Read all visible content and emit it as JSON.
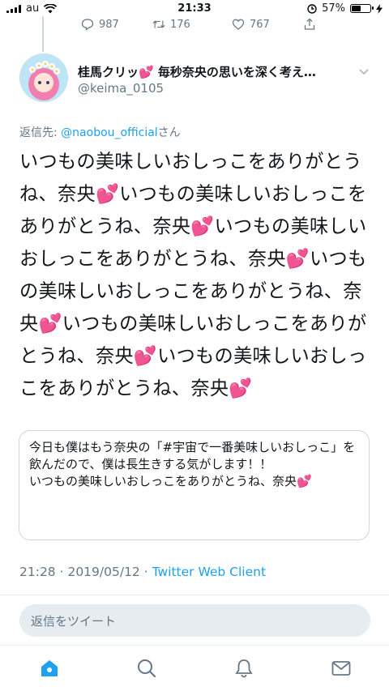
{
  "status_bar": {
    "carrier": "au",
    "time": "21:33",
    "battery_percent": "57%",
    "battery_level": 0.57
  },
  "previous_tweet_stats": {
    "replies": "987",
    "retweets": "176",
    "likes": "767"
  },
  "author": {
    "display_name": "桂馬クリッ💕 毎秒奈央の思いを深く考え…",
    "handle": "@keima_0105"
  },
  "reply_to": {
    "prefix": "返信先: ",
    "target": "@naobou_official",
    "suffix": "さん"
  },
  "tweet": {
    "text": "いつもの美味しいおしっこをありがとうね、奈央💕いつもの美味しいおしっこをありがとうね、奈央💕いつもの美味しいおしっこをありがとうね、奈央💕いつもの美味しいおしっこをありがとうね、奈央💕いつもの美味しいおしっこをありがとうね、奈央💕いつもの美味しいおしっこをありがとうね、奈央💕"
  },
  "quote": {
    "text": "今日も僕はもう奈央の「#宇宙で一番美味しいおしっこ」を飲んだので、僕は長生きする気がします！！\nいつもの美味しいおしっこをありがとうね、奈央💕"
  },
  "meta": {
    "time": "21:28",
    "separator1": " · ",
    "date": "2019/05/12",
    "separator2": " · ",
    "client": "Twitter Web Client"
  },
  "reply_box": {
    "placeholder": "返信をツイート"
  },
  "icons": {
    "status_bar": [
      "wifi-icon",
      "alarm-lock-icon",
      "charging-icon"
    ],
    "stats": [
      "reply-icon",
      "retweet-icon",
      "like-icon",
      "share-icon"
    ],
    "header": [
      "chevron-down-icon"
    ],
    "tabs": [
      "home-icon",
      "search-icon",
      "notifications-icon",
      "messages-icon"
    ]
  },
  "colors": {
    "accent": "#1da1f2",
    "secondary_text": "#657786",
    "border": "#ccd6dd"
  }
}
